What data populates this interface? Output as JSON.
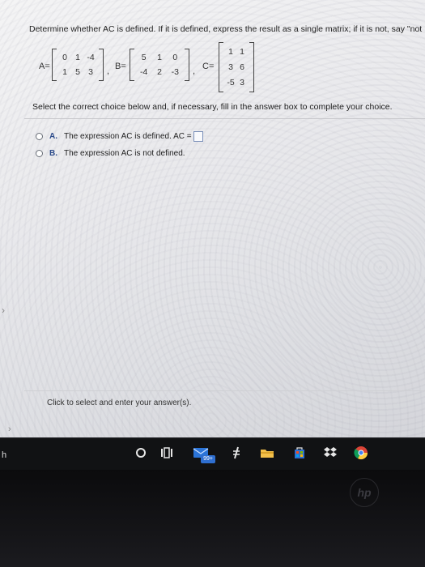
{
  "question": {
    "text": "Determine whether AC is defined. If it is defined, express the result as a single matrix; if it is not, say \"not"
  },
  "matrices": {
    "A": {
      "label": "A=",
      "rows": [
        [
          "0",
          "1",
          "-4"
        ],
        [
          "1",
          "5",
          "3"
        ]
      ]
    },
    "B": {
      "label": "B=",
      "rows": [
        [
          "5",
          "1",
          "0"
        ],
        [
          "-4",
          "2",
          "-3"
        ]
      ]
    },
    "C": {
      "label": "C=",
      "rows": [
        [
          "1",
          "1"
        ],
        [
          "3",
          "6"
        ],
        [
          "-5",
          "3"
        ]
      ]
    },
    "separators": [
      ",",
      ","
    ]
  },
  "instruction": "Select the correct choice below and, if necessary, fill in the answer box to complete your choice.",
  "choices": [
    {
      "letter": "A.",
      "text": "The expression AC is defined. AC ="
    },
    {
      "letter": "B.",
      "text": "The expression AC is not defined."
    }
  ],
  "footer_hint": "Click to select and enter your answer(s).",
  "taskbar": {
    "left_text": "h",
    "badge": "99+"
  },
  "colors": {
    "choice_letter": "#2b4a8a",
    "taskbar_bg": "#111214",
    "badge_bg": "#2f6fd1"
  }
}
